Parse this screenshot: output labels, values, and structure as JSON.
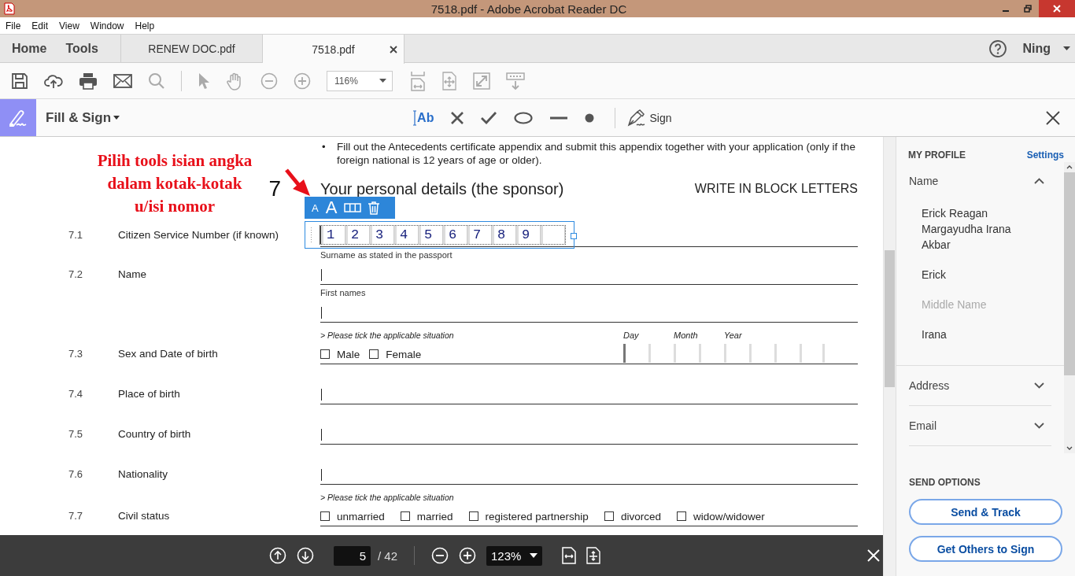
{
  "window": {
    "title": "7518.pdf - Adobe Acrobat Reader DC"
  },
  "menu": [
    "File",
    "Edit",
    "View",
    "Window",
    "Help"
  ],
  "nav": [
    "Home",
    "Tools"
  ],
  "tabs": [
    {
      "label": "RENEW DOC.pdf",
      "selected": false,
      "closable": false
    },
    {
      "label": "7518.pdf",
      "selected": true,
      "closable": true
    }
  ],
  "user": {
    "name": "Ning"
  },
  "toolbar": {
    "zoom": "116%"
  },
  "fill_sign": {
    "title": "Fill & Sign",
    "sign": "Sign",
    "tools": [
      {
        "kind": "text",
        "label": "Ab",
        "selected": true
      },
      {
        "kind": "cross",
        "selected": false
      },
      {
        "kind": "check",
        "selected": false
      },
      {
        "kind": "circle",
        "selected": false
      },
      {
        "kind": "line",
        "selected": false
      },
      {
        "kind": "dot",
        "selected": false
      }
    ]
  },
  "annotation": {
    "lines": [
      "Pilih tools isian angka",
      "dalam kotak-kotak",
      "u/isi nomor"
    ]
  },
  "document": {
    "bullet_mark": "•",
    "bullet": "Fill out the Antecedents certificate appendix and submit this appendix together with your application (only if the foreign national is 12 years of age or older).",
    "section_number": "7",
    "section_title": "Your personal details (the sponsor)",
    "section_note": "WRITE IN BLOCK LETTERS",
    "field_toolbar": {
      "small": "A",
      "large": "A"
    },
    "items": [
      {
        "kind": "comb",
        "number": "7.1",
        "label": "Citizen Service Number (if known)",
        "digits": [
          "1",
          "2",
          "3",
          "4",
          "5",
          "6",
          "7",
          "8",
          "9"
        ]
      },
      {
        "kind": "caption",
        "text": "Surname as stated in the passport"
      },
      {
        "kind": "line",
        "number": "7.2",
        "label": "Name"
      },
      {
        "kind": "caption",
        "text": "First names"
      },
      {
        "kind": "line"
      },
      {
        "kind": "hint",
        "text": "> Please tick the applicable situation",
        "date_labels": [
          "Day",
          "Month",
          "Year"
        ]
      },
      {
        "kind": "choices",
        "number": "7.3",
        "label": "Sex and Date of birth",
        "options": [
          {
            "label": "Male",
            "checked": false
          },
          {
            "label": "Female",
            "checked": false
          }
        ],
        "date_cells": [
          {
            "focused": true
          },
          {
            "focused": false
          },
          {
            "focused": false
          },
          {
            "focused": false
          },
          {
            "focused": false
          },
          {
            "focused": false
          },
          {
            "focused": false
          },
          {
            "focused": false
          }
        ]
      },
      {
        "kind": "line",
        "number": "7.4",
        "label": "Place of birth"
      },
      {
        "kind": "line",
        "number": "7.5",
        "label": "Country of birth"
      },
      {
        "kind": "line",
        "number": "7.6",
        "label": "Nationality"
      },
      {
        "kind": "hint",
        "text": "> Please tick the applicable situation"
      },
      {
        "kind": "choices",
        "number": "7.7",
        "label": "Civil status",
        "options": [
          {
            "label": "unmarried",
            "checked": false
          },
          {
            "label": "married",
            "checked": false
          },
          {
            "label": "registered partnership",
            "checked": false
          },
          {
            "label": "divorced",
            "checked": false
          },
          {
            "label": "widow/widower",
            "checked": false
          }
        ]
      }
    ]
  },
  "profile": {
    "title": "MY PROFILE",
    "settings": "Settings",
    "sections": [
      {
        "label": "Name",
        "expanded": true,
        "fields": [
          {
            "value": "Erick Reagan Margayudha Irana Akbar"
          },
          {
            "value": "Erick"
          },
          {
            "placeholder": "Middle Name"
          },
          {
            "value": "Irana"
          }
        ]
      },
      {
        "label": "Address",
        "expanded": false
      },
      {
        "label": "Email",
        "expanded": false
      }
    ]
  },
  "send_options": {
    "title": "SEND OPTIONS",
    "buttons": [
      "Send & Track",
      "Get Others to Sign"
    ]
  },
  "page_nav": {
    "page": "5",
    "total": "/ 42",
    "zoom": "123%"
  }
}
